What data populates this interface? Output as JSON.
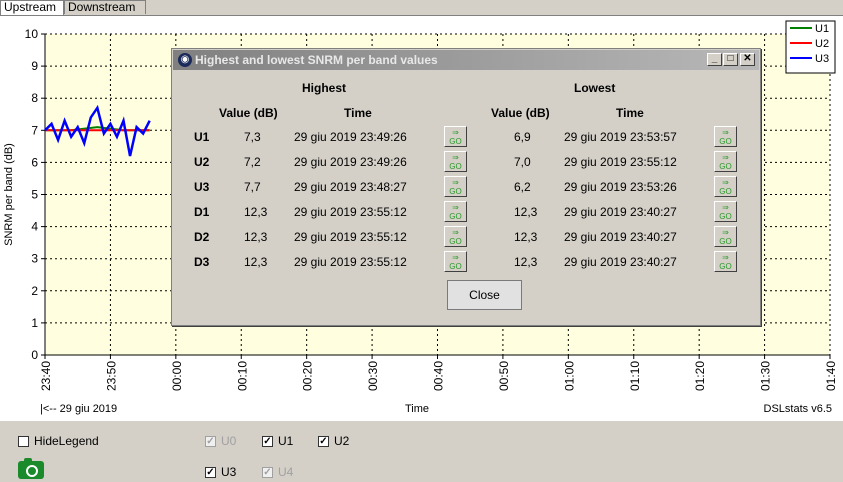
{
  "tabs": [
    {
      "label": "Upstream"
    },
    {
      "label": "Downstream"
    }
  ],
  "plot": {
    "ylabel": "SNRM per band (dB)",
    "xlabel": "Time",
    "date_marker": "|<-- 29 giu 2019",
    "version": "DSLstats v6.5",
    "yticks": [
      "0",
      "1",
      "2",
      "3",
      "4",
      "5",
      "6",
      "7",
      "8",
      "9",
      "10"
    ],
    "xticks": [
      "23:40",
      "23:50",
      "00:00",
      "00:10",
      "00:20",
      "00:30",
      "00:40",
      "00:50",
      "01:00",
      "01:10",
      "01:20",
      "01:30",
      "01:40"
    ],
    "legend": [
      {
        "name": "U1",
        "color": "#008000"
      },
      {
        "name": "U2",
        "color": "#ff0000"
      },
      {
        "name": "U3",
        "color": "#0000ff"
      }
    ]
  },
  "chart_data": {
    "type": "line",
    "title": "",
    "xlabel": "Time",
    "ylabel": "SNRM per band (dB)",
    "ylim": [
      0,
      10
    ],
    "x_range": [
      "23:40",
      "01:40"
    ],
    "grid": true,
    "legend_position": "top-right",
    "series": [
      {
        "name": "U1",
        "color": "#008000",
        "x": [
          "23:40",
          "23:44",
          "23:48",
          "23:52",
          "23:56"
        ],
        "values": [
          7.0,
          7.0,
          7.1,
          7.0,
          7.0
        ]
      },
      {
        "name": "U2",
        "color": "#ff0000",
        "x": [
          "23:40",
          "23:44",
          "23:48",
          "23:52",
          "23:56"
        ],
        "values": [
          7.0,
          7.0,
          7.0,
          7.0,
          7.0
        ]
      },
      {
        "name": "U3",
        "color": "#0000ff",
        "x": [
          "23:40",
          "23:41",
          "23:42",
          "23:43",
          "23:44",
          "23:45",
          "23:46",
          "23:47",
          "23:48",
          "23:49",
          "23:50",
          "23:51",
          "23:52",
          "23:53",
          "23:54",
          "23:55",
          "23:56"
        ],
        "values": [
          7.0,
          7.2,
          6.7,
          7.3,
          6.8,
          7.1,
          6.6,
          7.4,
          7.7,
          6.9,
          7.2,
          6.8,
          7.3,
          6.2,
          7.1,
          6.9,
          7.3
        ]
      }
    ]
  },
  "dialog": {
    "title": "Highest and lowest SNRM per band values",
    "highest": "Highest",
    "lowest": "Lowest",
    "value_header": "Value (dB)",
    "time_header": "Time",
    "go_label": "GO",
    "close": "Close",
    "rows": [
      {
        "band": "U1",
        "high_val": "7,3",
        "high_time": "29 giu 2019 23:49:26",
        "low_val": "6,9",
        "low_time": "29 giu 2019 23:53:57"
      },
      {
        "band": "U2",
        "high_val": "7,2",
        "high_time": "29 giu 2019 23:49:26",
        "low_val": "7,0",
        "low_time": "29 giu 2019 23:55:12"
      },
      {
        "band": "U3",
        "high_val": "7,7",
        "high_time": "29 giu 2019 23:48:27",
        "low_val": "6,2",
        "low_time": "29 giu 2019 23:53:26"
      },
      {
        "band": "D1",
        "high_val": "12,3",
        "high_time": "29 giu 2019 23:55:12",
        "low_val": "12,3",
        "low_time": "29 giu 2019 23:40:27"
      },
      {
        "band": "D2",
        "high_val": "12,3",
        "high_time": "29 giu 2019 23:55:12",
        "low_val": "12,3",
        "low_time": "29 giu 2019 23:40:27"
      },
      {
        "band": "D3",
        "high_val": "12,3",
        "high_time": "29 giu 2019 23:55:12",
        "low_val": "12,3",
        "low_time": "29 giu 2019 23:40:27"
      }
    ]
  },
  "controls": {
    "hide_legend": "HideLegend",
    "checks": [
      {
        "label": "U0",
        "checked": true,
        "enabled": false
      },
      {
        "label": "U1",
        "checked": true,
        "enabled": true
      },
      {
        "label": "U2",
        "checked": true,
        "enabled": true
      },
      {
        "label": "U3",
        "checked": true,
        "enabled": true
      },
      {
        "label": "U4",
        "checked": true,
        "enabled": false
      }
    ]
  }
}
